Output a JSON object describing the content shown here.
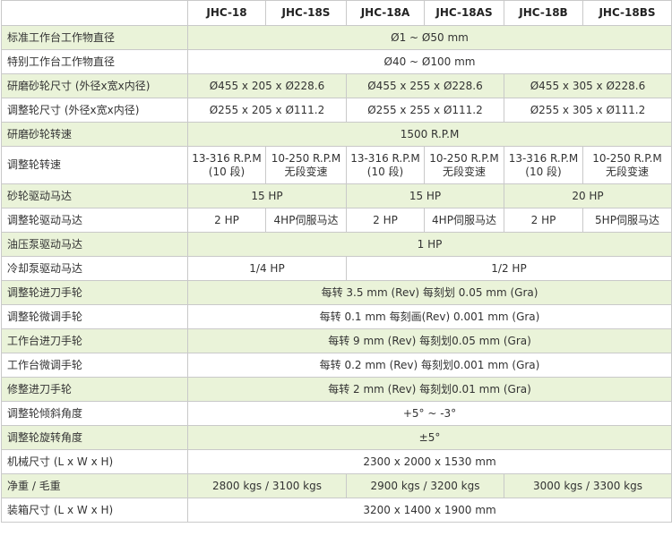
{
  "headers": [
    "JHC-18",
    "JHC-18S",
    "JHC-18A",
    "JHC-18AS",
    "JHC-18B",
    "JHC-18BS"
  ],
  "rows": [
    {
      "label": "标准工作台工作物直径",
      "cells": [
        "Ø1 ~ Ø50 mm"
      ]
    },
    {
      "label": "特别工作台工作物直径",
      "cells": [
        "Ø40 ~ Ø100 mm"
      ]
    },
    {
      "label": "研磨砂轮尺寸 (外径x宽x内径)",
      "cells": [
        "Ø455 x 205 x Ø228.6",
        "Ø455 x 255 x Ø228.6",
        "Ø455 x 305 x Ø228.6"
      ]
    },
    {
      "label": "调整轮尺寸 (外径x宽x内径)",
      "cells": [
        "Ø255 x 205 x Ø111.2",
        "Ø255 x 255 x Ø111.2",
        "Ø255 x 305 x Ø111.2"
      ]
    },
    {
      "label": "研磨砂轮转速",
      "cells": [
        "1500 R.P.M"
      ]
    },
    {
      "label": "调整轮转速",
      "cells": [
        [
          "13-316 R.P.M",
          "(10 段)"
        ],
        [
          "10-250 R.P.M",
          "无段变速"
        ],
        [
          "13-316 R.P.M",
          "(10 段)"
        ],
        [
          "10-250 R.P.M",
          "无段变速"
        ],
        [
          "13-316 R.P.M",
          "(10 段)"
        ],
        [
          "10-250 R.P.M",
          "无段变速"
        ]
      ]
    },
    {
      "label": "砂轮驱动马达",
      "cells": [
        "15 HP",
        "15 HP",
        "20 HP"
      ]
    },
    {
      "label": "调整轮驱动马达",
      "cells": [
        "2 HP",
        "4HP伺服马达",
        "2 HP",
        "4HP伺服马达",
        "2 HP",
        "5HP伺服马达"
      ]
    },
    {
      "label": "油压泵驱动马达",
      "cells": [
        "1 HP"
      ]
    },
    {
      "label": "冷却泵驱动马达",
      "cells": [
        "1/4 HP",
        "1/2 HP"
      ]
    },
    {
      "label": "调整轮进刀手轮",
      "cells": [
        "每转 3.5 mm (Rev) 每刻划 0.05 mm (Gra)"
      ]
    },
    {
      "label": "调整轮微调手轮",
      "cells": [
        "每转 0.1 mm 每刻画(Rev) 0.001 mm (Gra)"
      ]
    },
    {
      "label": "工作台进刀手轮",
      "cells": [
        "每转 9 mm (Rev) 每刻划0.05 mm (Gra)"
      ]
    },
    {
      "label": "工作台微调手轮",
      "cells": [
        "每转 0.2 mm (Rev) 每刻划0.001 mm (Gra)"
      ]
    },
    {
      "label": "修整进刀手轮",
      "cells": [
        "每转 2 mm (Rev) 每刻划0.01 mm (Gra)"
      ]
    },
    {
      "label": "调整轮倾斜角度",
      "cells": [
        "+5° ~ -3°"
      ]
    },
    {
      "label": "调整轮旋转角度",
      "cells": [
        "±5°"
      ]
    },
    {
      "label": "机械尺寸 (L x W x H)",
      "cells": [
        "2300 x 2000 x 1530 mm"
      ]
    },
    {
      "label": "净重 / 毛重",
      "cells": [
        "2800 kgs / 3100 kgs",
        "2900 kgs / 3200 kgs",
        "3000 kgs / 3300 kgs"
      ]
    },
    {
      "label": "装箱尺寸 (L x W x H)",
      "cells": [
        "3200 x 1400 x 1900 mm"
      ]
    }
  ]
}
